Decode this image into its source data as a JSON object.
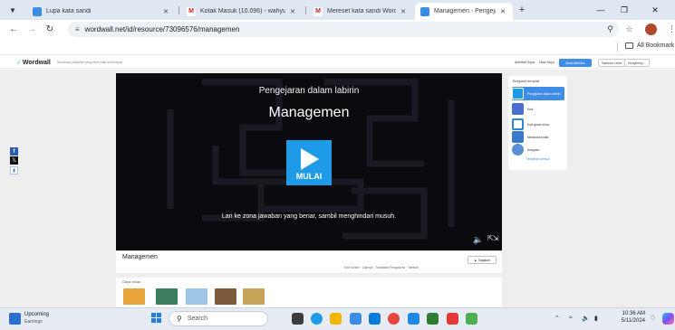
{
  "browser": {
    "tabs": [
      {
        "title": "Lupa kata sandi",
        "favicon_color": "#3a8de0",
        "active": false
      },
      {
        "title": "Kotak Masuk (10.096) - wahyu",
        "favicon_color": "#c5221f",
        "active": false
      },
      {
        "title": "Mereset kata sandi Wordwall A",
        "favicon_color": "#c5221f",
        "active": false
      },
      {
        "title": "Managemen - Pengejaran dala",
        "favicon_color": "#3a8de0",
        "active": true
      }
    ],
    "url": "wordwall.net/id/resource/73096576/managemen",
    "bookmarks_label": "All Bookmark"
  },
  "site": {
    "logo": "Wordwall",
    "tagline": "Membuat pelajaran yang lebih baik lebih cepat",
    "nav_links": [
      "Aktivitas Saya",
      "Hasil Saya"
    ],
    "create_label": "Buat Aktivitas",
    "upgrade_label": "Naikkan Level",
    "account_label": "Hungeriety..."
  },
  "game": {
    "subtitle": "Pengejaran dalam labirin",
    "title": "Managemen",
    "start_label": "MULAI",
    "instruction": "Lari ke zona jawaban yang benar, sambil menghindari musuh."
  },
  "templates": {
    "heading": "Berganti templat",
    "items": [
      {
        "label": "Pengejaran dalam labirin",
        "color": "#1f9ae6",
        "selected": true
      },
      {
        "label": "Kuis",
        "color": "#4a6fd1",
        "selected": false
      },
      {
        "label": "Kuis game show",
        "color": "#2e86d8",
        "selected": false
      },
      {
        "label": "Membuka kotak",
        "color": "#3a78c9",
        "selected": false
      },
      {
        "label": "Anagram",
        "color": "#5a8fd8",
        "selected": false
      }
    ],
    "more_label": "Tampilkan semua"
  },
  "activity": {
    "title": "Managemen",
    "share_label": "Bagikan",
    "meta": [
      "Edit Konten",
      "Lainnya",
      "Tampilkan Pengaturan",
      "Tambah"
    ]
  },
  "themes": {
    "heading": "Gaya visual",
    "colors": [
      "#e8a33a",
      "#3b7d5c",
      "#9dc5e8",
      "#7d5a3c",
      "#c8a45a"
    ]
  },
  "taskbar": {
    "earnings_title": "Upcoming",
    "earnings_sub": "Earnings",
    "search_placeholder": "Search",
    "apps": [
      "#3c3c3c",
      "#1f9ae6",
      "#f2b705",
      "#3a8de0",
      "#0a7bd6",
      "#e8453c",
      "#2e7d32",
      "#1e88e5",
      "#e53935",
      "#4caf50"
    ],
    "time": "10:36 AM",
    "date": "5/11/2024"
  }
}
